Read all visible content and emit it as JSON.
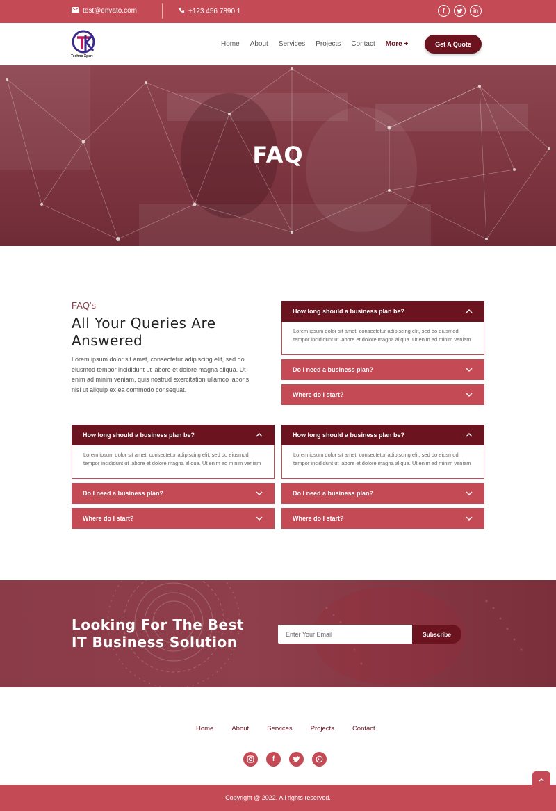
{
  "topbar": {
    "email": "test@envato.com",
    "phone": "+123 456 7890 1",
    "socials": [
      "facebook-icon",
      "twitter-icon",
      "linkedin-icon"
    ]
  },
  "nav": {
    "logo_text": "Techno Xpert",
    "items": [
      "Home",
      "About",
      "Services",
      "Projects",
      "Contact"
    ],
    "more_label": "More +",
    "quote_label": "Get A Quote"
  },
  "hero": {
    "title": "FAQ"
  },
  "faq_intro": {
    "kicker": "FAQ's",
    "title": "All Your Queries Are Answered",
    "description": "Lorem ipsum dolor sit amet, consectetur adipiscing elit, sed do eiusmod tempor incididunt ut labore et dolore magna aliqua. Ut enim ad minim veniam, quis nostrud exercitation ullamco laboris nisi ut aliquip ex ea commodo consequat."
  },
  "accordions": [
    {
      "items": [
        {
          "question": "How long should a business plan be?",
          "answer": "Lorem ipsum dolor sit amet, consectetur adipiscing elit, sed do eiusmod tempor incididunt ut labore et dolore magna aliqua. Ut enim ad minim veniam",
          "open": true
        },
        {
          "question": "Do I need a business plan?",
          "open": false
        },
        {
          "question": "Where do I start?",
          "open": false
        }
      ]
    },
    {
      "items": [
        {
          "question": "How long should a business plan be?",
          "answer": "Lorem ipsum dolor sit amet, consectetur adipiscing elit, sed do eiusmod tempor incididunt ut labore et dolore magna aliqua. Ut enim ad minim veniam",
          "open": true
        },
        {
          "question": "Do I need a business plan?",
          "open": false
        },
        {
          "question": "Where do I start?",
          "open": false
        }
      ]
    },
    {
      "items": [
        {
          "question": "How long should a business plan be?",
          "answer": "Lorem ipsum dolor sit amet, consectetur adipiscing elit, sed do eiusmod tempor incididunt ut labore et dolore magna aliqua. Ut enim ad minim veniam",
          "open": true
        },
        {
          "question": "Do I need a business plan?",
          "open": false
        },
        {
          "question": "Where do I start?",
          "open": false
        }
      ]
    }
  ],
  "cta": {
    "title": "Looking For The Best IT Business Solution",
    "email_placeholder": "Enter Your Email",
    "subscribe_label": "Subscribe"
  },
  "footer": {
    "links": [
      "Home",
      "About",
      "Services",
      "Projects",
      "Contact"
    ],
    "socials": [
      "instagram-icon",
      "facebook-icon",
      "twitter-icon",
      "whatsapp-icon"
    ],
    "copyright": "Copyright @ 2022. All rights reserved."
  },
  "colors": {
    "primary": "#c44a56",
    "dark": "#6b1420"
  }
}
